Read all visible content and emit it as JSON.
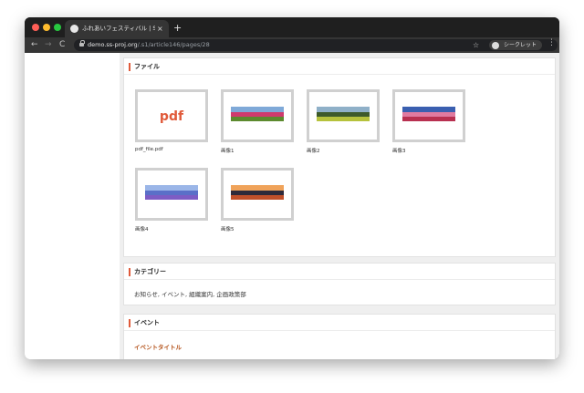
{
  "browser": {
    "tab_title": "ふれあいフェスティバル | SHIRASA",
    "tab_close": "×",
    "new_tab": "+",
    "nav_back": "←",
    "nav_forward": "→",
    "nav_reload": "C",
    "url_domain": "demo.ss-proj.org",
    "url_path": "/.s1/article146/pages/28",
    "bookmark": "☆",
    "incognito_label": "シークレット",
    "menu": "⋮"
  },
  "files_section": {
    "title": "ファイル",
    "files": [
      {
        "caption": "pdf_file.pdf",
        "type": "pdf",
        "badge": "pdf"
      },
      {
        "caption": "画像1",
        "type": "image",
        "palette": [
          "#7fa9d8",
          "#cf3a6e",
          "#5c8a2e"
        ]
      },
      {
        "caption": "画像2",
        "type": "image",
        "palette": [
          "#8fb0c8",
          "#3d5a2a",
          "#b6c23c"
        ]
      },
      {
        "caption": "画像3",
        "type": "image",
        "palette": [
          "#3a5fb0",
          "#e07aa0",
          "#b83050"
        ]
      },
      {
        "caption": "画像4",
        "type": "image",
        "palette": [
          "#9bb6e8",
          "#5a6fc8",
          "#7d5cc4"
        ]
      },
      {
        "caption": "画像5",
        "type": "image",
        "palette": [
          "#f0a35a",
          "#2e2a3a",
          "#c0502a"
        ]
      }
    ]
  },
  "category_section": {
    "title": "カテゴリー",
    "text": "お知らせ, イベント, 組織案内, 企画政策部"
  },
  "event_section": {
    "title": "イベント",
    "link": "イベントタイトル"
  },
  "colors": {
    "accent": "#e05a3a",
    "link": "#b5541d"
  }
}
